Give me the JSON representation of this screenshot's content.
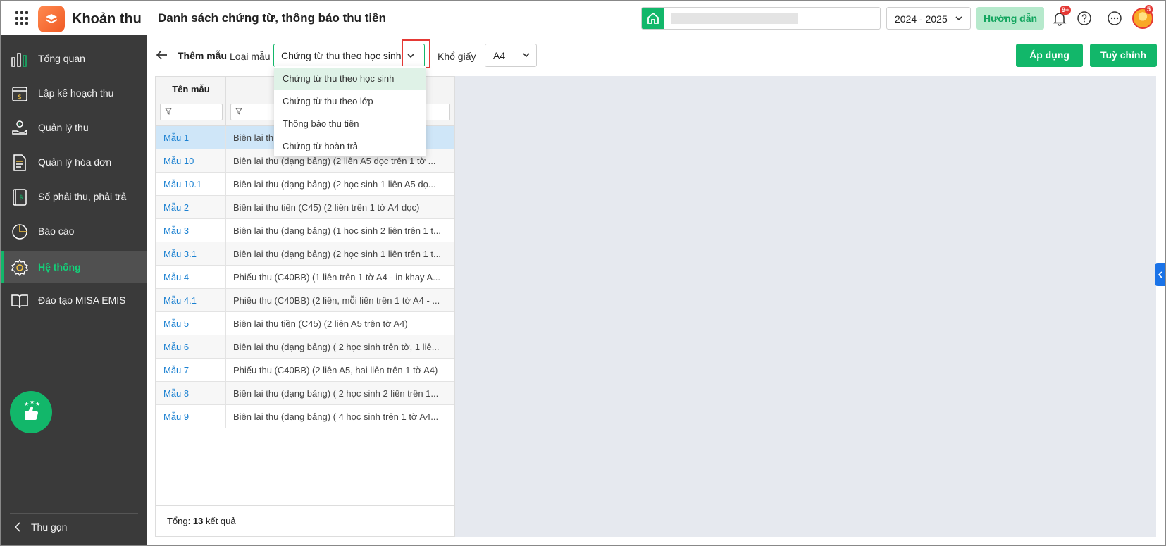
{
  "header": {
    "app_title": "Khoản thu",
    "page_title": "Danh sách chứng từ, thông báo thu tiền",
    "year": "2024 - 2025",
    "guide_label": "Hướng dẫn",
    "notification_badge": "9+",
    "avatar_badge": "5"
  },
  "sidebar": {
    "items": [
      {
        "label": "Tổng quan",
        "icon": "chart-bars-icon"
      },
      {
        "label": "Lập kế hoạch thu",
        "icon": "calendar-dollar-icon"
      },
      {
        "label": "Quản lý thu",
        "icon": "hand-coin-icon"
      },
      {
        "label": "Quản lý hóa đơn",
        "icon": "document-icon"
      },
      {
        "label": "Sổ phải thu, phải trả",
        "icon": "ledger-icon"
      },
      {
        "label": "Báo cáo",
        "icon": "pie-chart-icon"
      },
      {
        "label": "Hệ thống",
        "icon": "gear-icon"
      },
      {
        "label": "Đào tạo MISA EMIS",
        "icon": "book-open-icon"
      }
    ],
    "active_index": 6,
    "collapse_label": "Thu gọn"
  },
  "toolbar": {
    "title": "Thêm mẫu",
    "type_label": "Loại mẫu",
    "type_value": "Chứng từ thu theo học sinh",
    "paper_label": "Khổ giấy",
    "paper_value": "A4",
    "apply_label": "Áp dụng",
    "customize_label": "Tuỳ chỉnh"
  },
  "dropdown": {
    "options": [
      "Chứng từ thu theo học sinh",
      "Chứng từ thu theo lớp",
      "Thông báo thu tiền",
      "Chứng từ hoàn trả"
    ],
    "selected_index": 0
  },
  "table": {
    "col1_header": "Tên mẫu",
    "rows": [
      {
        "name": "Mẫu 1",
        "desc": "Biên lai thu"
      },
      {
        "name": "Mẫu 10",
        "desc": "Biên lai thu (dạng bảng) (2 liên A5 dọc trên 1 tờ ..."
      },
      {
        "name": "Mẫu 10.1",
        "desc": "Biên lai thu (dạng bảng) (2 học sinh 1 liên A5 dọ..."
      },
      {
        "name": "Mẫu 2",
        "desc": "Biên lai thu tiền (C45) (2 liên trên 1 tờ A4 dọc)"
      },
      {
        "name": "Mẫu 3",
        "desc": "Biên lai thu (dạng bảng) (1 học sinh 2 liên trên 1 t..."
      },
      {
        "name": "Mẫu 3.1",
        "desc": "Biên lai thu (dạng bảng) (2 học sinh 1 liên trên 1 t..."
      },
      {
        "name": "Mẫu 4",
        "desc": "Phiếu thu (C40BB) (1 liên trên 1 tờ A4 - in khay A..."
      },
      {
        "name": "Mẫu 4.1",
        "desc": "Phiếu thu (C40BB) (2 liên, mỗi liên trên 1 tờ A4 - ..."
      },
      {
        "name": "Mẫu 5",
        "desc": "Biên lai thu tiền (C45) (2 liên A5 trên tờ A4)"
      },
      {
        "name": "Mẫu 6",
        "desc": "Biên lai thu (dạng bảng) ( 2 học sinh trên tờ, 1 liê..."
      },
      {
        "name": "Mẫu 7",
        "desc": "Phiếu thu (C40BB) (2 liên A5, hai liên trên 1 tờ A4)"
      },
      {
        "name": "Mẫu 8",
        "desc": "Biên lai thu (dạng bảng) ( 2 học sinh 2 liên trên 1..."
      },
      {
        "name": "Mẫu 9",
        "desc": "Biên lai thu (dạng bảng) ( 4 học sinh trên 1 tờ A4..."
      }
    ],
    "total_prefix": "Tổng:",
    "total_count": "13",
    "total_suffix": "kết quả"
  },
  "colors": {
    "accent": "#12b76a",
    "sidebar_bg": "#3a3a3a",
    "link": "#1a80d1",
    "selected_row": "#cfe6f8",
    "highlight_box": "#e53935"
  }
}
